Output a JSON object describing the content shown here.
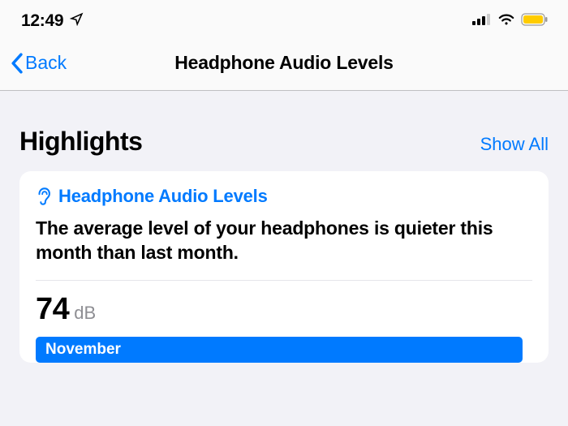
{
  "statusBar": {
    "time": "12:49"
  },
  "nav": {
    "backLabel": "Back",
    "title": "Headphone Audio Levels"
  },
  "highlights": {
    "title": "Highlights",
    "showAllLabel": "Show All"
  },
  "card": {
    "headerTitle": "Headphone Audio Levels",
    "description": "The average level of your headphones is quieter this month than last month.",
    "statValue": "74",
    "statUnit": "dB",
    "barLabel": "November"
  }
}
